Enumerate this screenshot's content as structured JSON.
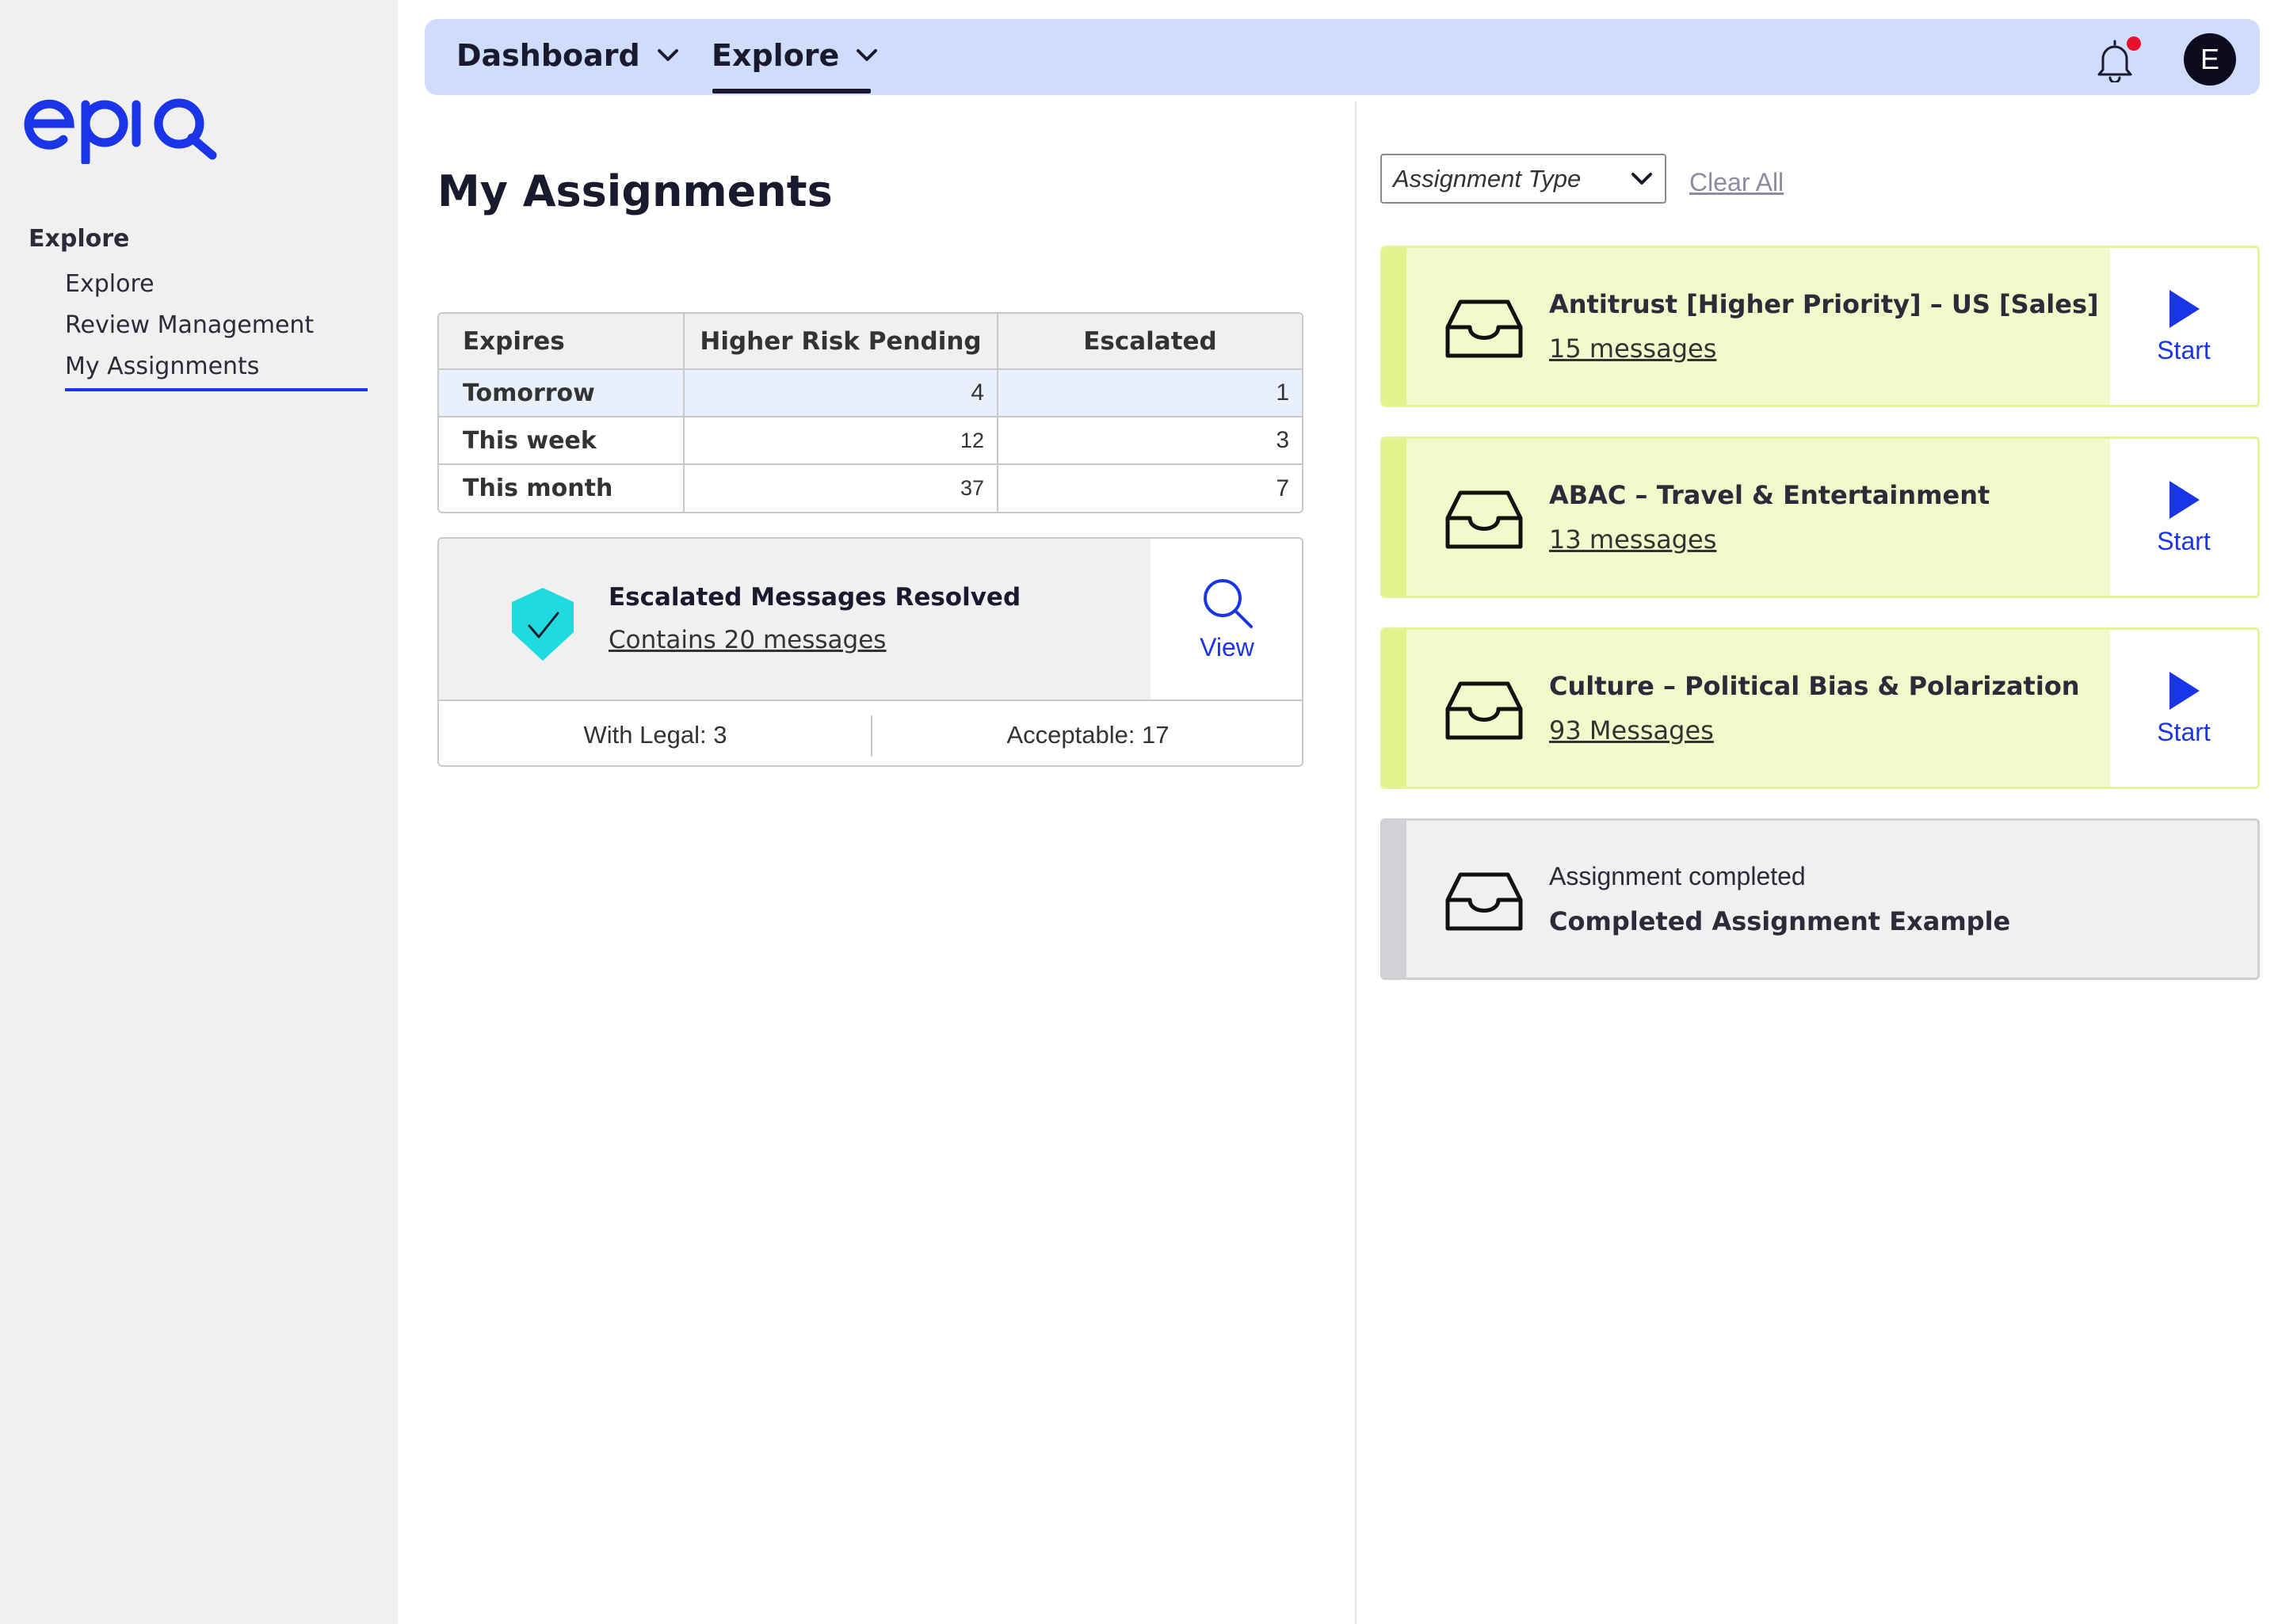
{
  "brand": {
    "logo_text": "epiq",
    "color": "#1a35e8"
  },
  "sidebar": {
    "heading": "Explore",
    "items": [
      {
        "label": "Explore",
        "active": false
      },
      {
        "label": "Review Management",
        "active": false
      },
      {
        "label": "My Assignments",
        "active": true
      }
    ]
  },
  "topbar": {
    "nav": [
      {
        "label": "Dashboard",
        "icon": "chevron-down-icon",
        "active": false
      },
      {
        "label": "Explore",
        "icon": "chevron-down-icon",
        "active": true
      }
    ],
    "notifications": {
      "icon": "bell-icon",
      "has_unread": true
    },
    "avatar_initial": "E"
  },
  "main": {
    "title": "My Assignments",
    "expires_table": {
      "headers": [
        "Expires",
        "Higher Risk Pending",
        "Escalated"
      ],
      "rows": [
        {
          "label": "Tomorrow",
          "higher_risk_pending": "4",
          "escalated": "1"
        },
        {
          "label": "This week",
          "higher_risk_pending": "12",
          "escalated": "3"
        },
        {
          "label": "This month",
          "higher_risk_pending": "37",
          "escalated": "7"
        }
      ]
    },
    "resolved_card": {
      "icon": "shield-check-icon",
      "title": "Escalated Messages Resolved",
      "link": "Contains 20 messages",
      "view_label": "View",
      "stats": [
        "With Legal: 3",
        "Acceptable: 17"
      ]
    }
  },
  "filters": {
    "assignment_type_placeholder": "Assignment Type",
    "clear_all": "Clear All"
  },
  "assignments": [
    {
      "title": "Antitrust [Higher Priority] –  US [Sales]",
      "link": "15 messages",
      "action": "Start"
    },
    {
      "title": "ABAC – Travel & Entertainment",
      "link": "13 messages",
      "action": "Start"
    },
    {
      "title": "Culture – Political Bias & Polarization",
      "link": "93 Messages",
      "action": "Start"
    }
  ],
  "completed_assignment": {
    "status": "Assignment completed",
    "title": "Completed Assignment Example"
  },
  "colors": {
    "accent": "#1a35e8",
    "topbar": "#cfdcfc",
    "card_active_bg": "#f2f9cb",
    "card_active_border": "#e4f49a",
    "card_done_bg": "#f0f0f0",
    "shield": "#1edbe0",
    "notification_dot": "#e8102a"
  }
}
